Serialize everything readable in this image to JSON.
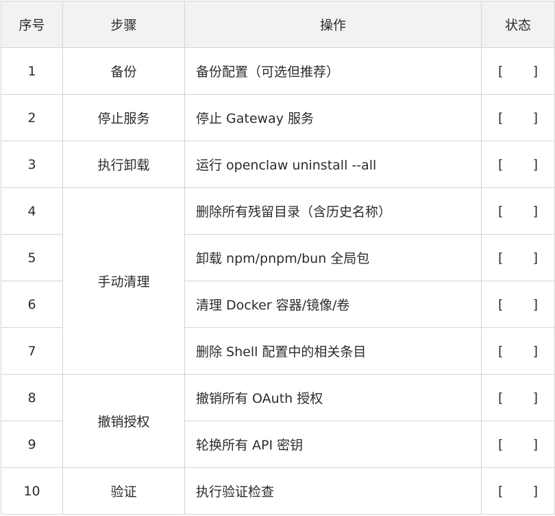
{
  "headers": {
    "index": "序号",
    "step": "步骤",
    "operation": "操作",
    "status": "状态"
  },
  "rows": [
    {
      "index": "1",
      "step": "备份",
      "operation": "备份配置（可选但推荐）",
      "status_open": "[",
      "status_close": "]"
    },
    {
      "index": "2",
      "step": "停止服务",
      "operation": "停止 Gateway 服务",
      "status_open": "[",
      "status_close": "]"
    },
    {
      "index": "3",
      "step": "执行卸载",
      "operation": "运行 openclaw uninstall --all",
      "status_open": "[",
      "status_close": "]"
    },
    {
      "index": "4",
      "step": "手动清理",
      "operation": "删除所有残留目录（含历史名称）",
      "status_open": "[",
      "status_close": "]"
    },
    {
      "index": "5",
      "step": "",
      "operation": "卸载 npm/pnpm/bun 全局包",
      "status_open": "[",
      "status_close": "]"
    },
    {
      "index": "6",
      "step": "",
      "operation": "清理 Docker 容器/镜像/卷",
      "status_open": "[",
      "status_close": "]"
    },
    {
      "index": "7",
      "step": "",
      "operation": "删除 Shell 配置中的相关条目",
      "status_open": "[",
      "status_close": "]"
    },
    {
      "index": "8",
      "step": "撤销授权",
      "operation": "撤销所有 OAuth 授权",
      "status_open": "[",
      "status_close": "]"
    },
    {
      "index": "9",
      "step": "",
      "operation": "轮换所有 API 密钥",
      "status_open": "[",
      "status_close": "]"
    },
    {
      "index": "10",
      "step": "验证",
      "operation": "执行验证检查",
      "status_open": "[",
      "status_close": "]"
    }
  ]
}
